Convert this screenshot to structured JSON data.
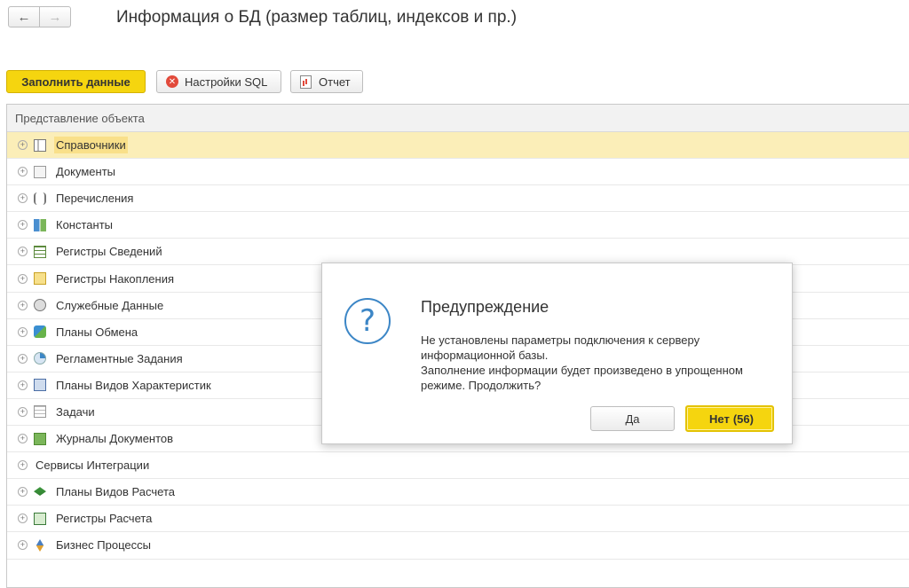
{
  "window": {
    "title": "Информация о БД (размер таблиц, индексов и пр.)",
    "back_icon": "arrow-left-icon",
    "forward_icon": "arrow-right-icon"
  },
  "toolbar": {
    "fill_label": "Заполнить данные",
    "sql_settings_label": "Настройки SQL",
    "report_label": "Отчет"
  },
  "table": {
    "column_header": "Представление объекта",
    "rows": [
      {
        "label": "Справочники",
        "icon": "catalog-icon",
        "selected": true,
        "expandable": true
      },
      {
        "label": "Документы",
        "icon": "document-icon",
        "expandable": true
      },
      {
        "label": "Перечисления",
        "icon": "enum-icon",
        "expandable": true
      },
      {
        "label": "Константы",
        "icon": "constants-icon",
        "expandable": true
      },
      {
        "label": "Регистры Сведений",
        "icon": "info-register-icon",
        "expandable": true
      },
      {
        "label": "Регистры Накопления",
        "icon": "accumulation-register-icon",
        "expandable": true
      },
      {
        "label": "Служебные Данные",
        "icon": "service-data-icon",
        "expandable": true
      },
      {
        "label": "Планы Обмена",
        "icon": "exchange-plan-icon",
        "expandable": true
      },
      {
        "label": "Регламентные Задания",
        "icon": "scheduled-job-icon",
        "expandable": true
      },
      {
        "label": "Планы Видов Характеристик",
        "icon": "characteristic-plan-icon",
        "expandable": true
      },
      {
        "label": "Задачи",
        "icon": "task-icon",
        "expandable": true
      },
      {
        "label": "Журналы Документов",
        "icon": "document-journal-icon",
        "expandable": true
      },
      {
        "label": "Сервисы Интеграции",
        "icon": "",
        "expandable": true
      },
      {
        "label": "Планы Видов Расчета",
        "icon": "calculation-plan-icon",
        "expandable": true
      },
      {
        "label": "Регистры Расчета",
        "icon": "calculation-register-icon",
        "expandable": true
      },
      {
        "label": "Бизнес Процессы",
        "icon": "business-process-icon",
        "expandable": true
      }
    ]
  },
  "dialog": {
    "title": "Предупреждение",
    "icon": "question-icon",
    "message_line1": "Не установлены параметры подключения к серверу",
    "message_line2": "информационной базы.",
    "message_line3": "Заполнение информации будет произведено в упрощенном",
    "message_line4": "режиме. Продолжить?",
    "yes_label": "Да",
    "no_label": "Нет",
    "no_countdown": "(56)"
  },
  "colors": {
    "accent_yellow": "#f5d50f",
    "selected_row": "#fbeeb8",
    "question_blue": "#3c86c6",
    "error_red": "#e24a3b"
  }
}
